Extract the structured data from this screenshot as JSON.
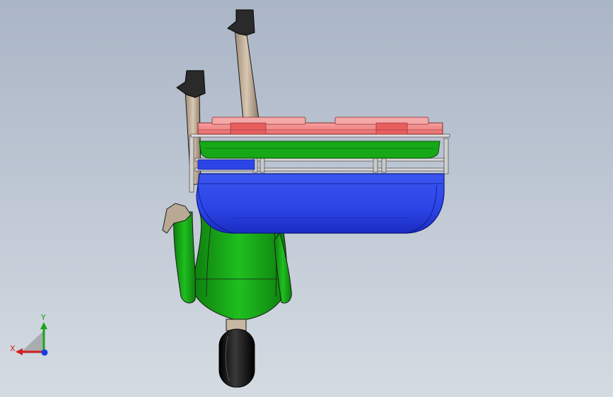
{
  "viewport": {
    "background_top": "#aab5c6",
    "background_bottom": "#d4dbe2"
  },
  "colors": {
    "seat_blue": "#2b44e6",
    "frame_green": "#17a817",
    "tray_pink": "#f08a8a",
    "handle_tan": "#c7b29a",
    "grip_dark": "#2a2a2a",
    "wheel_black": "#0e0e0e",
    "edge_line": "#1a1a1a"
  },
  "triad": {
    "x_label": "X",
    "y_label": "Y",
    "x_color": "#d42020",
    "y_color": "#1aa31a",
    "z_color": "#1a3fe0"
  }
}
